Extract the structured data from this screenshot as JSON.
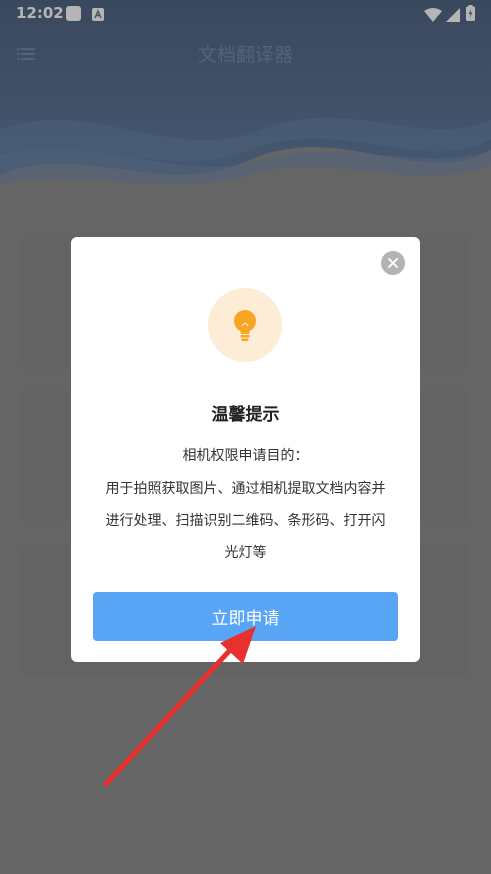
{
  "status_bar": {
    "time": "12:02"
  },
  "header": {
    "title": "文档翻译器"
  },
  "dialog": {
    "title": "温馨提示",
    "purpose_heading": "相机权限申请目的：",
    "purpose_line1": "用于拍照获取图片、通过相机提取文档内容并",
    "purpose_line2": "进行处理、扫描识别二维码、条形码、打开闪",
    "purpose_line3": "光灯等",
    "apply_button": "立即申请"
  },
  "colors": {
    "header_blue": "#2f4a72",
    "button_blue": "#59a5f5",
    "bulb_orange": "#f6a623",
    "bulb_bg": "#fdecd6",
    "arrow_red": "#e8302e"
  },
  "icons": {
    "menu": "menu-icon",
    "close": "close-icon",
    "bulb": "lightbulb-icon",
    "wifi": "wifi-icon",
    "signal": "signal-icon",
    "battery": "battery-charging-icon"
  }
}
